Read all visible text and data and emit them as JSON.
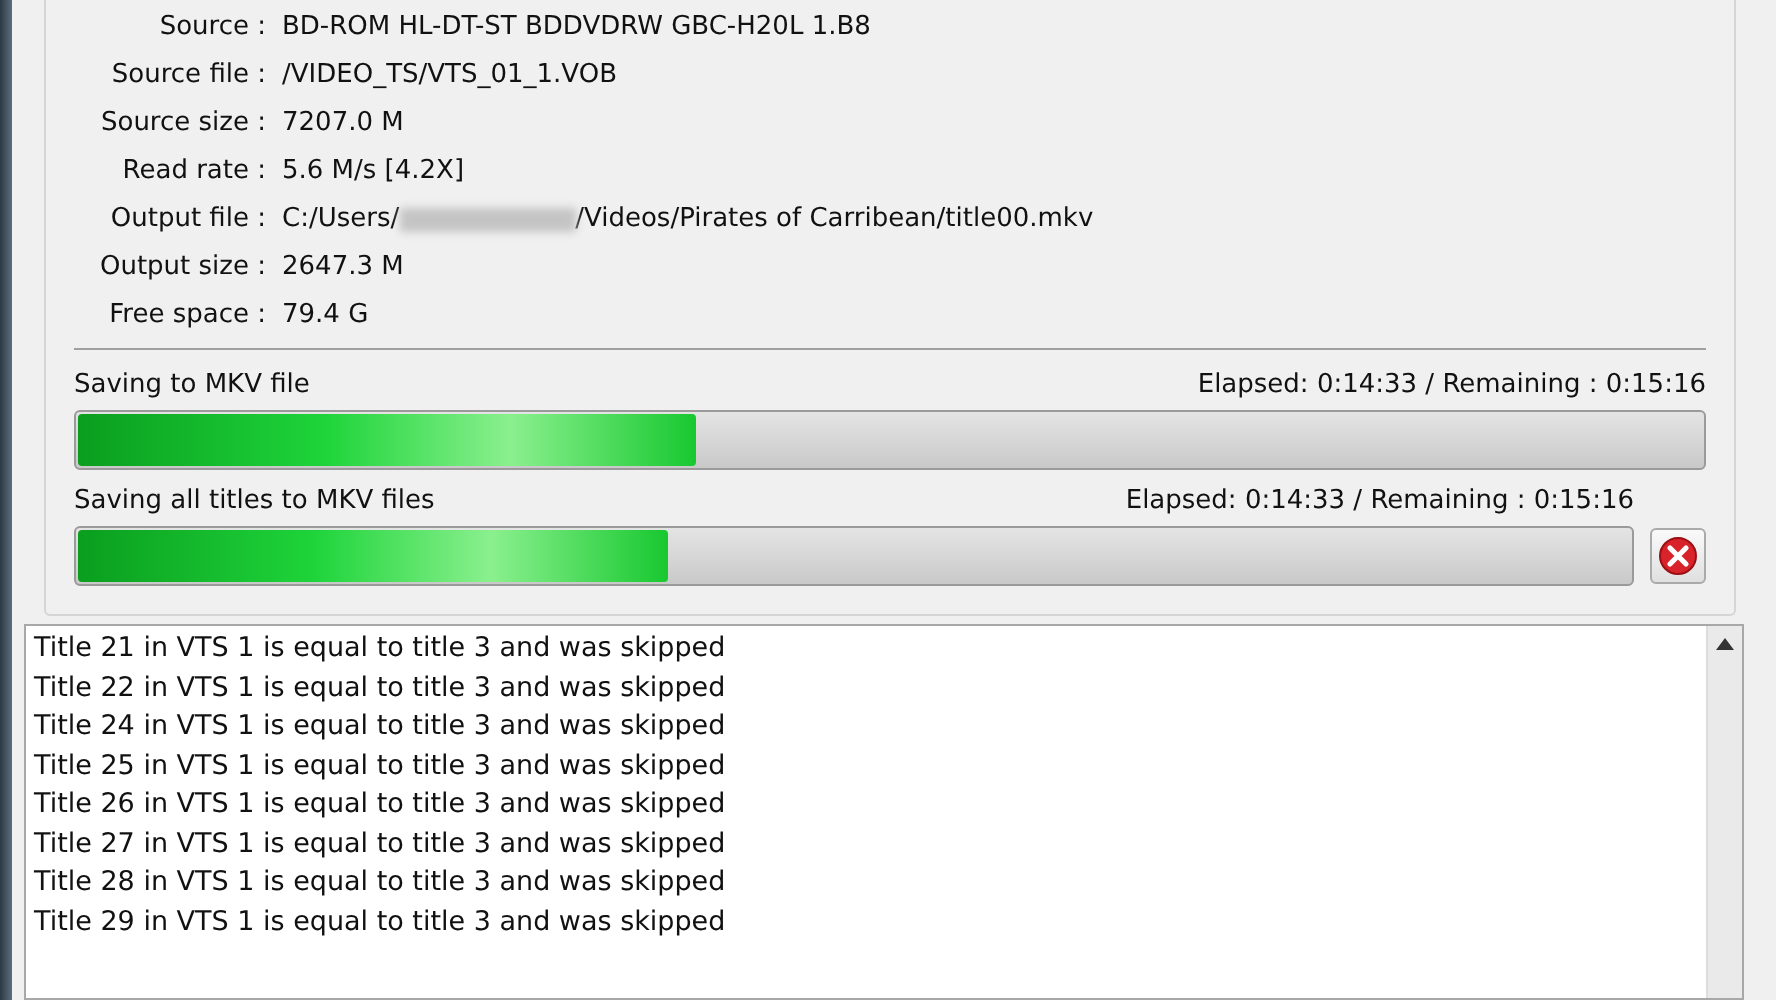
{
  "info": [
    {
      "label": "Source :",
      "value": "BD-ROM HL-DT-ST BDDVDRW GBC-H20L 1.B8"
    },
    {
      "label": "Source file :",
      "value": "/VIDEO_TS/VTS_01_1.VOB"
    },
    {
      "label": "Source size :",
      "value": "7207.0 M"
    },
    {
      "label": "Read rate :",
      "value": "5.6 M/s [4.2X]"
    },
    {
      "label": "Output file :",
      "value": "C:/Users/",
      "redacted": true,
      "value_after": "/Videos/Pirates of Carribean/title00.mkv"
    },
    {
      "label": "Output size :",
      "value": "2647.3 M"
    },
    {
      "label": "Free space :",
      "value": "79.4 G"
    }
  ],
  "progress": [
    {
      "label": "Saving to MKV file",
      "time": "Elapsed: 0:14:33 / Remaining : 0:15:16",
      "level": 0.38,
      "cancel": false
    },
    {
      "label": "Saving all titles to MKV files",
      "time": "Elapsed: 0:14:33 / Remaining : 0:15:16",
      "level": 0.38,
      "cancel": true
    }
  ],
  "log": [
    "Title 21 in VTS 1 is equal to title 3 and was skipped",
    "Title 22 in VTS 1 is equal to title 3 and was skipped",
    "Title 24 in VTS 1 is equal to title 3 and was skipped",
    "Title 25 in VTS 1 is equal to title 3 and was skipped",
    "Title 26 in VTS 1 is equal to title 3 and was skipped",
    "Title 27 in VTS 1 is equal to title 3 and was skipped",
    "Title 28 in VTS 1 is equal to title 3 and was skipped",
    "Title 29 in VTS 1 is equal to title 3 and was skipped"
  ]
}
